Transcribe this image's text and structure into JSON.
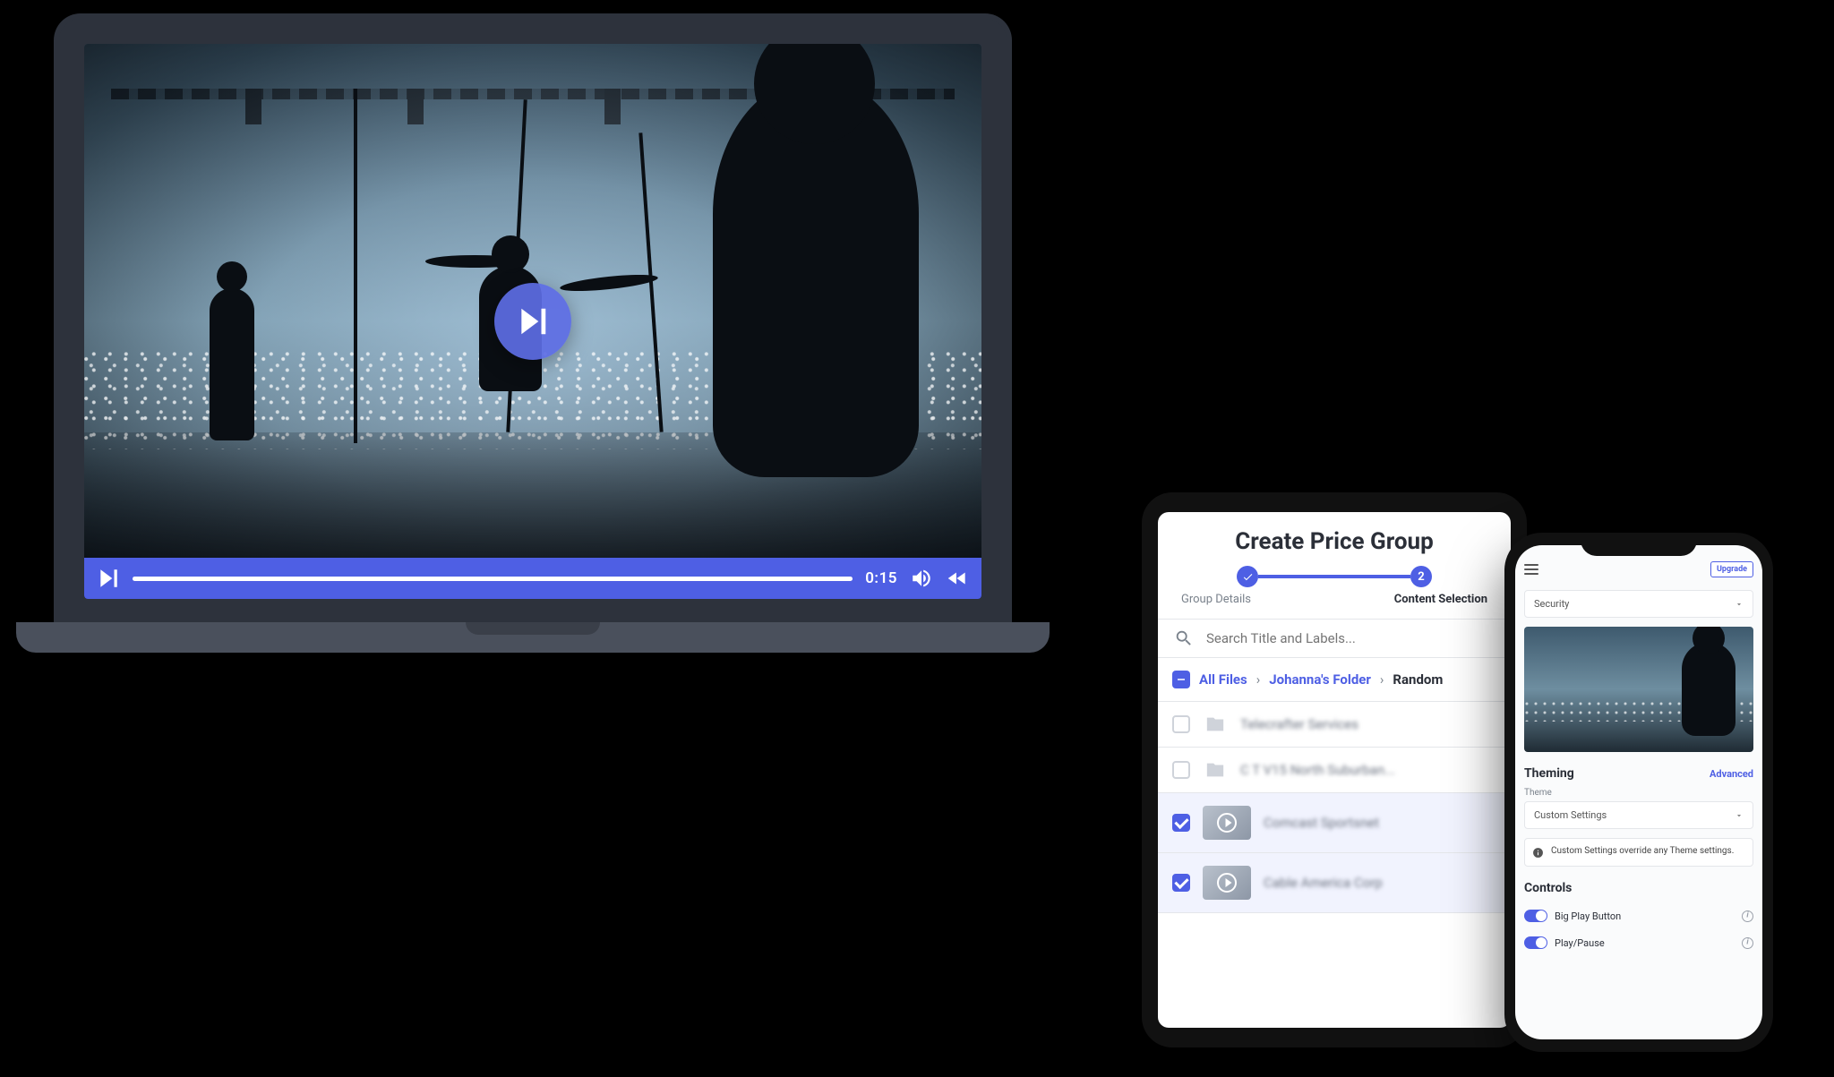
{
  "colors": {
    "accent": "#4e5fe4"
  },
  "player": {
    "time": "0:15",
    "icons": {
      "center_play": "play-next-icon",
      "play": "play-next-icon",
      "volume": "volume-icon",
      "rewind": "rewind-icon"
    }
  },
  "tablet": {
    "title": "Create Price Group",
    "steps": [
      {
        "label": "Group Details",
        "state": "done"
      },
      {
        "label": "Content Selection",
        "state": "active",
        "number": "2"
      }
    ],
    "search_placeholder": "Search Title and Labels...",
    "breadcrumb": {
      "root": "All Files",
      "mid": "Johanna's Folder",
      "current": "Random"
    },
    "rows": [
      {
        "type": "folder",
        "label": "Telecrafter Services",
        "checked": false
      },
      {
        "type": "folder",
        "label": "C T V15 North Suburban...",
        "checked": false
      },
      {
        "type": "video",
        "label": "Comcast Sportsnet",
        "checked": true
      },
      {
        "type": "video",
        "label": "Cable America Corp",
        "checked": true
      }
    ]
  },
  "phone": {
    "upgrade_label": "Upgrade",
    "select_value": "Security",
    "theming": {
      "heading": "Theming",
      "advanced": "Advanced",
      "theme_label": "Theme",
      "theme_value": "Custom Settings",
      "note": "Custom Settings override any Theme settings."
    },
    "controls": {
      "heading": "Controls",
      "items": [
        {
          "label": "Big Play Button",
          "on": true
        },
        {
          "label": "Play/Pause",
          "on": true
        }
      ]
    }
  }
}
